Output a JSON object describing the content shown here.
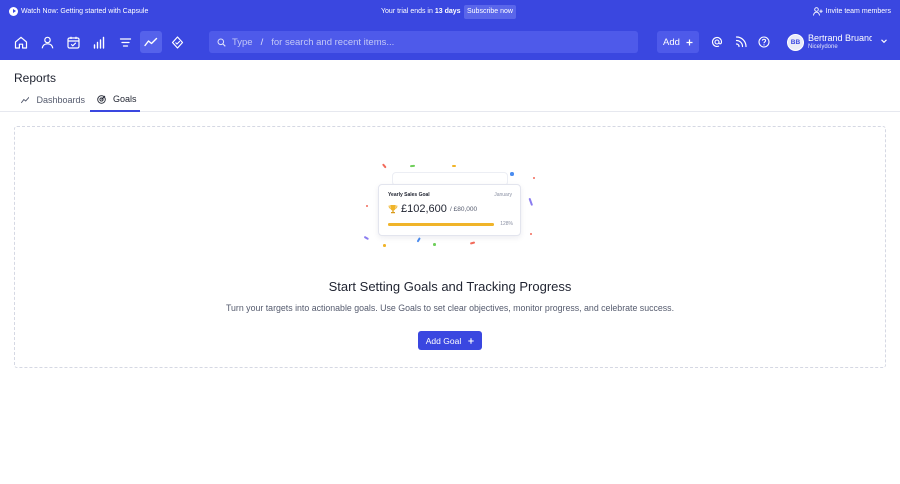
{
  "banner": {
    "watch_label": "Watch Now: Getting started with Capsule",
    "trial_prefix": "Your trial ends in",
    "trial_days": "13 days",
    "subscribe_label": "Subscribe now",
    "invite_label": "Invite team members"
  },
  "nav": {
    "icons": [
      "home-icon",
      "person-icon",
      "calendar-icon",
      "bar-chart-icon",
      "list-icon",
      "reports-icon",
      "activity-icon"
    ],
    "active": "reports-icon",
    "search_type": "Type",
    "search_slash": "/",
    "search_placeholder": "for search and recent items...",
    "add_label": "Add",
    "user_initials": "BB",
    "user_name": "Bertrand Bruandet",
    "user_org": "Nicelydone"
  },
  "page": {
    "title": "Reports",
    "tabs": [
      {
        "label": "Dashboards",
        "icon": "line-chart-icon",
        "active": false
      },
      {
        "label": "Goals",
        "icon": "goal-icon",
        "active": true
      }
    ]
  },
  "empty_state": {
    "card": {
      "title": "Yearly Sales Goal",
      "month": "January",
      "amount": "£102,600",
      "target": "/ £80,000",
      "percent_label": "128%",
      "progress": 1.0
    },
    "headline": "Start Setting Goals and Tracking Progress",
    "subtext": "Turn your targets into actionable goals. Use Goals to set clear objectives, monitor progress, and celebrate success.",
    "button_label": "Add Goal"
  },
  "colors": {
    "brand": "#3a47e0",
    "goal_bar": "#f0b429"
  }
}
